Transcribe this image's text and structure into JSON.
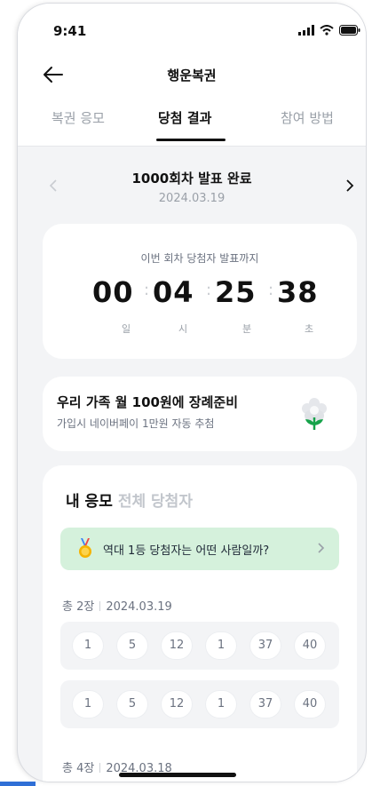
{
  "status_bar": {
    "time": "9:41"
  },
  "header": {
    "title": "행운복권"
  },
  "tabs": [
    {
      "label": "복권 응모"
    },
    {
      "label": "당첨 결과"
    },
    {
      "label": "참여 방법"
    }
  ],
  "round": {
    "title": "1000회차 발표 완료",
    "date": "2024.03.19"
  },
  "countdown": {
    "caption": "이번 회차 당첨자 발표까지",
    "values": [
      "00",
      "04",
      "25",
      "38"
    ],
    "units": [
      "일",
      "시",
      "분",
      "초"
    ]
  },
  "promo": {
    "title": "우리 가족 월 100원에 장례준비",
    "subtitle": "가입시 네이버페이 1만원 자동 추첨"
  },
  "my_entries": {
    "tab_active": "내 응모",
    "tab_inactive": "전체 당첨자",
    "banner": "역대 1등 당첨자는 어떤 사람일까?",
    "groups": [
      {
        "count": "총 2장",
        "date": "2024.03.19",
        "rows": [
          [
            "1",
            "5",
            "12",
            "1",
            "37",
            "40"
          ],
          [
            "1",
            "5",
            "12",
            "1",
            "37",
            "40"
          ]
        ]
      },
      {
        "count": "총 4장",
        "date": "2024.03.18",
        "rows": []
      }
    ]
  },
  "colors": {
    "banner_bg": "#d5f1dc",
    "accent": "#2f6fd6"
  }
}
